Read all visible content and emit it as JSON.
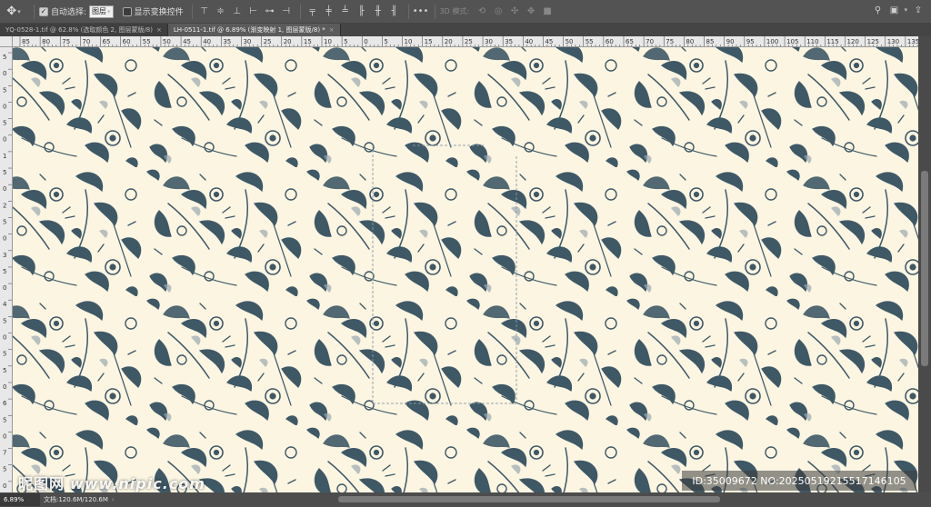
{
  "options_bar": {
    "move_tool_icon": "move-icon",
    "auto_select_label": "自动选择:",
    "auto_select_checked": true,
    "auto_select_value": "图层",
    "show_transform_label": "显示变换控件",
    "show_transform_checked": false,
    "mode_3d_label": "3D 模式:",
    "more_label": "•••"
  },
  "tabs": [
    {
      "label": "YQ-0528-1.tif @ 62.8% (选取颜色 2, 图层蒙版/8)",
      "active": false
    },
    {
      "label": "LH-0511-1.tif @ 6.89% (渐变映射 1, 图层蒙版/8) *",
      "active": true
    }
  ],
  "ruler_h_labels": [
    "85",
    "80",
    "75",
    "70",
    "65",
    "60",
    "55",
    "50",
    "45",
    "40",
    "35",
    "30",
    "25",
    "20",
    "15",
    "10",
    "5",
    "0",
    "5",
    "10",
    "15",
    "20",
    "25",
    "30",
    "35",
    "40",
    "45",
    "50",
    "55",
    "60",
    "65",
    "70",
    "75",
    "80",
    "85",
    "90",
    "95",
    "100",
    "105",
    "110",
    "115",
    "120",
    "125",
    "130",
    "135"
  ],
  "ruler_v_labels": [
    "5",
    "0",
    "5",
    "0",
    "5",
    "0",
    "1",
    "5",
    "0",
    "2",
    "5",
    "0",
    "3",
    "5",
    "0",
    "4",
    "5",
    "0",
    "5",
    "5",
    "0",
    "6",
    "5",
    "0",
    "7",
    "5",
    "0"
  ],
  "status": {
    "zoom": "6.89%",
    "doc_size": "文档:120.6M/120.6M",
    "more": "›"
  },
  "watermarks": {
    "left_cn": "昵图网",
    "left_url": "www.nipic.com",
    "right_id": "ID:35009672 NO:20250519215517146105"
  },
  "colors": {
    "pattern_bg": "#fbf5e2",
    "pattern_ink": "#3f5866",
    "ui_bg": "#535353"
  }
}
